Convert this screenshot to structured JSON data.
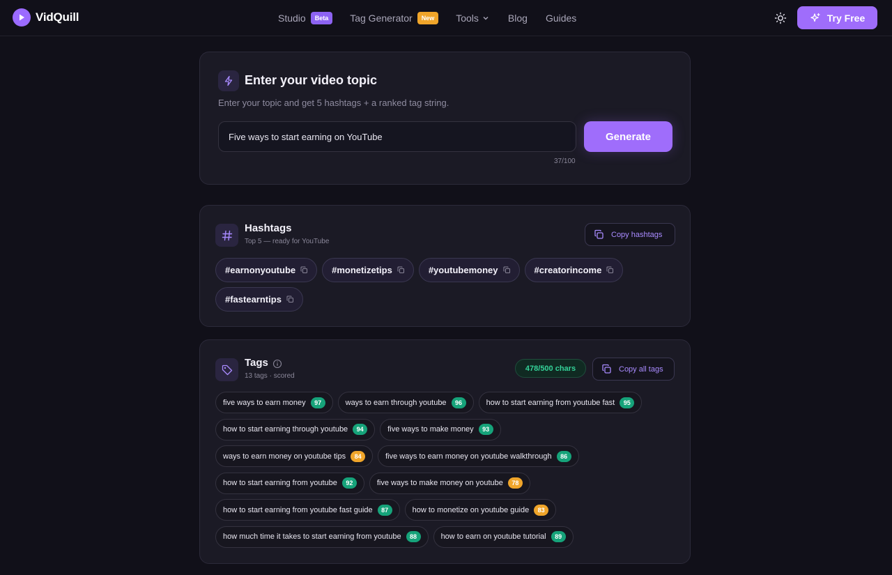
{
  "brand": {
    "name": "VidQuill"
  },
  "nav": {
    "studio": "Studio",
    "studio_badge": "Beta",
    "tag_generator": "Tag Generator",
    "tag_generator_badge": "New",
    "tools": "Tools",
    "blog": "Blog",
    "guides": "Guides"
  },
  "header": {
    "try_free": "Try Free"
  },
  "topic": {
    "title": "Enter your video topic",
    "subtitle": "Enter your topic and get 5 hashtags + a ranked tag string.",
    "input_value": "Five ways to start earning on YouTube",
    "generate": "Generate",
    "char_count": "37/100"
  },
  "hashtags": {
    "title": "Hashtags",
    "subtitle": "Top 5 — ready for YouTube",
    "copy_label": "Copy hashtags",
    "items": [
      "#earnonyoutube",
      "#monetizetips",
      "#youtubemoney",
      "#creatorincome",
      "#fastearntips"
    ]
  },
  "tags": {
    "title": "Tags",
    "subtitle": "13 tags · scored",
    "char_count": "478/500 chars",
    "copy_label": "Copy all tags",
    "items": [
      {
        "text": "five ways to earn money",
        "score": "97",
        "level": "green"
      },
      {
        "text": "ways to earn through youtube",
        "score": "96",
        "level": "green"
      },
      {
        "text": "how to start earning from youtube fast",
        "score": "95",
        "level": "green"
      },
      {
        "text": "how to start earning through youtube",
        "score": "94",
        "level": "green"
      },
      {
        "text": "five ways to make money",
        "score": "93",
        "level": "green"
      },
      {
        "text": "ways to earn money on youtube tips",
        "score": "84",
        "level": "amber"
      },
      {
        "text": "five ways to earn money on youtube walkthrough",
        "score": "86",
        "level": "green"
      },
      {
        "text": "how to start earning from youtube",
        "score": "92",
        "level": "green"
      },
      {
        "text": "five ways to make money on youtube",
        "score": "78",
        "level": "amber"
      },
      {
        "text": "how to start earning from youtube fast guide",
        "score": "87",
        "level": "green"
      },
      {
        "text": "how to monetize on youtube guide",
        "score": "83",
        "level": "amber"
      },
      {
        "text": "how much time it takes to start earning from youtube",
        "score": "88",
        "level": "green"
      },
      {
        "text": "how to earn on youtube tutorial",
        "score": "89",
        "level": "green"
      }
    ]
  },
  "colors": {
    "accent": "#9f6dfb",
    "background": "#111019",
    "card": "#1b1a25",
    "score_green": "#16a37a",
    "score_amber": "#f0a52a"
  }
}
